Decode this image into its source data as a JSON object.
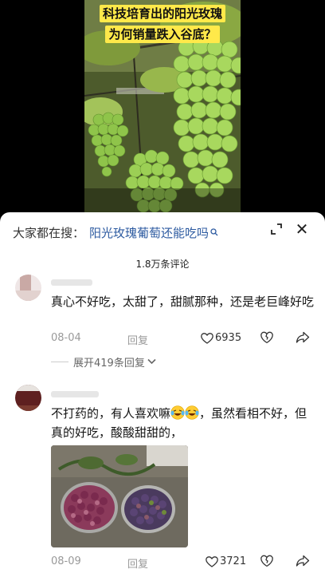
{
  "video": {
    "caption_line1": "科技培育出的阳光玫瑰",
    "caption_line2": "为何销量跌入谷底？"
  },
  "sheet": {
    "search_prefix": "大家都在搜：",
    "search_query": "阳光玫瑰葡萄还能吃吗",
    "search_icon": "search-icon",
    "collapse_icon": "collapse-icon",
    "close_icon": "close-icon",
    "close_glyph": "✕",
    "comment_count": "1.8万条评论"
  },
  "comments": [
    {
      "text": "真心不好吃，太甜了，甜腻那种，还是老巨峰好吃",
      "date": "08-04",
      "reply_label": "回复",
      "likes": "6935",
      "expand_label": "展开419条回复"
    },
    {
      "text_part1": "不打药的，有人喜欢嘛",
      "text_part2": "，虽然看相不好，但真的好吃，酸酸甜甜的，",
      "emoji": "laughing-tears-emoji",
      "date": "08-09",
      "reply_label": "回复",
      "likes": "3721"
    }
  ],
  "colors": {
    "caption_bg": "#ffe94a",
    "link": "#2c5aa0",
    "meta": "#999999"
  }
}
